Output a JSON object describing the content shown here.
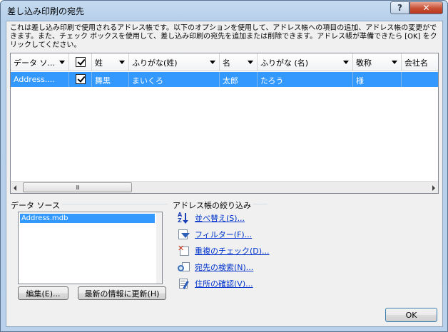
{
  "window": {
    "title": "差し込み印刷の宛先",
    "help_label": "?",
    "close_label": "✕"
  },
  "description": "これは差し込み印刷で使用されるアドレス帳です。以下のオプションを使用して、アドレス帳への項目の追加、アドレス帳の変更ができます。また、チェック ボックスを使用して、差し込み印刷の宛先を追加または削除できます。アドレス帳が準備できたら [OK] をクリックしてください。",
  "table": {
    "columns": [
      "データ ソ...",
      "",
      "姓",
      "ふりがな(姓)",
      "名",
      "ふりがな (名)",
      "敬称",
      "会社名"
    ],
    "rows": [
      {
        "source": "Address....",
        "checked": true,
        "last": "舞黒",
        "last_kana": "まいくろ",
        "first": "太郎",
        "first_kana": "たろう",
        "honorific": "様",
        "company": ""
      }
    ],
    "scroll_grip": "III"
  },
  "datasource": {
    "label": "データ ソース",
    "items": [
      "Address.mdb"
    ],
    "edit_button": "編集(E)...",
    "refresh_button": "最新の情報に更新(H)"
  },
  "refine": {
    "label": "アドレス帳の絞り込み",
    "links": [
      {
        "label": "並べ替え(S)...",
        "icon": "sort-icon"
      },
      {
        "label": "フィルター(F)...",
        "icon": "filter-icon"
      },
      {
        "label": "重複のチェック(D)...",
        "icon": "duplicate-check-icon"
      },
      {
        "label": "宛先の検索(N)...",
        "icon": "find-recipient-icon"
      },
      {
        "label": "住所の確認(V)...",
        "icon": "validate-address-icon"
      }
    ]
  },
  "ok_button": "OK"
}
